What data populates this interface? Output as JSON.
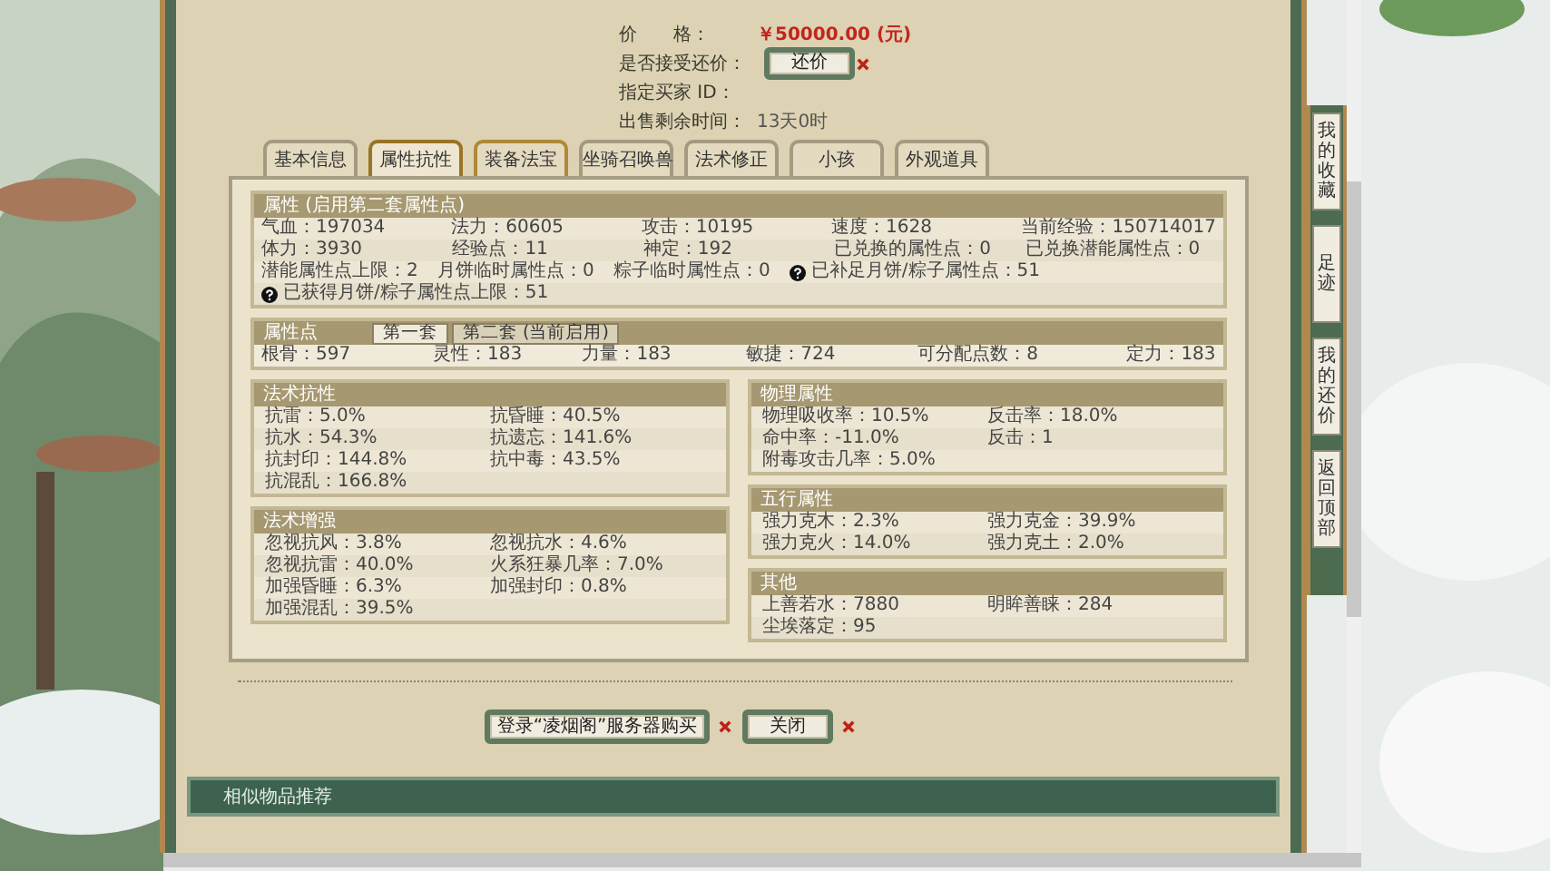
{
  "listing": [
    {
      "kind": "price",
      "label": "价　　格：",
      "value": "￥50000.00 (元)"
    },
    {
      "kind": "button",
      "label": "是否接受还价：",
      "value": "还价"
    },
    {
      "kind": "label",
      "label": "指定买家 ID："
    },
    {
      "kind": "text",
      "label": "出售剩余时间：",
      "value": "13天0时"
    }
  ],
  "tabs": [
    {
      "label": "基本信息",
      "selected": false,
      "hovered": false
    },
    {
      "label": "属性抗性",
      "selected": true,
      "hovered": false
    },
    {
      "label": "装备法宝",
      "selected": false,
      "hovered": true
    },
    {
      "label": "坐骑召唤兽",
      "selected": false,
      "hovered": false
    },
    {
      "label": "法术修正",
      "selected": false,
      "hovered": false
    },
    {
      "label": "小孩",
      "selected": false,
      "hovered": false
    },
    {
      "label": "外观道具",
      "selected": false,
      "hovered": false
    }
  ],
  "attributes": {
    "title": "属性 (启用第二套属性点)",
    "rows": [
      [
        {
          "text": "气血：197034",
          "help": false
        },
        {
          "text": "法力：60605",
          "help": false
        },
        {
          "text": "攻击：10195",
          "help": false
        },
        {
          "text": "速度：1628",
          "help": false
        },
        {
          "text": "当前经验：150714017",
          "help": false
        }
      ],
      [
        {
          "text": "体力：3930",
          "help": false
        },
        {
          "text": "经验点：11",
          "help": false
        },
        {
          "text": "神定：192",
          "help": false
        },
        {
          "text": "已兑换的属性点：0",
          "help": false
        },
        {
          "text": "已兑换潜能属性点：0",
          "help": false
        }
      ],
      [
        {
          "text": "潜能属性点上限：2",
          "help": false
        },
        {
          "text": "月饼临时属性点：0",
          "help": false
        },
        {
          "text": "粽子临时属性点：0",
          "help": false
        },
        {
          "text": "已补足月饼/粽子属性点：51",
          "help": true
        }
      ],
      [
        {
          "text": "已获得月饼/粽子属性点上限：51",
          "help": true
        }
      ]
    ]
  },
  "attribute_points": {
    "title": "属性点",
    "tabs": [
      {
        "label": "第一套",
        "selected": true
      },
      {
        "label": "第二套 (当前启用)",
        "selected": false
      }
    ],
    "cells": [
      "根骨：597",
      "灵性：183",
      "力量：183",
      "敏捷：724",
      "可分配点数：8",
      "定力：183"
    ]
  },
  "left_panels": [
    {
      "title": "法术抗性",
      "cells": [
        "抗雷：5.0%",
        "抗昏睡：40.5%",
        "抗水：54.3%",
        "抗遗忘：141.6%",
        "抗封印：144.8%",
        "抗中毒：43.5%",
        "抗混乱：166.8%"
      ]
    },
    {
      "title": "法术增强",
      "cells": [
        "忽视抗风：3.8%",
        "忽视抗水：4.6%",
        "忽视抗雷：40.0%",
        "火系狂暴几率：7.0%",
        "加强昏睡：6.3%",
        "加强封印：0.8%",
        "加强混乱：39.5%"
      ]
    }
  ],
  "right_panels": [
    {
      "title": "物理属性",
      "cells": [
        "物理吸收率：10.5%",
        "反击率：18.0%",
        "命中率：-11.0%",
        "反击：1",
        "附毒攻击几率：5.0%"
      ]
    },
    {
      "title": "五行属性",
      "cells": [
        "强力克木：2.3%",
        "强力克金：39.9%",
        "强力克火：14.0%",
        "强力克土：2.0%"
      ]
    },
    {
      "title": "其他",
      "cells": [
        "上善若水：7880",
        "明眸善睐：284",
        "尘埃落定：95"
      ]
    }
  ],
  "actions": [
    "登录“凌烟阁”服务器购买",
    "关闭"
  ],
  "similar_bar": {
    "title": "相似物品推荐"
  },
  "side_nav": [
    "我的收藏",
    "足迹",
    "我的还价",
    "返回顶部"
  ]
}
